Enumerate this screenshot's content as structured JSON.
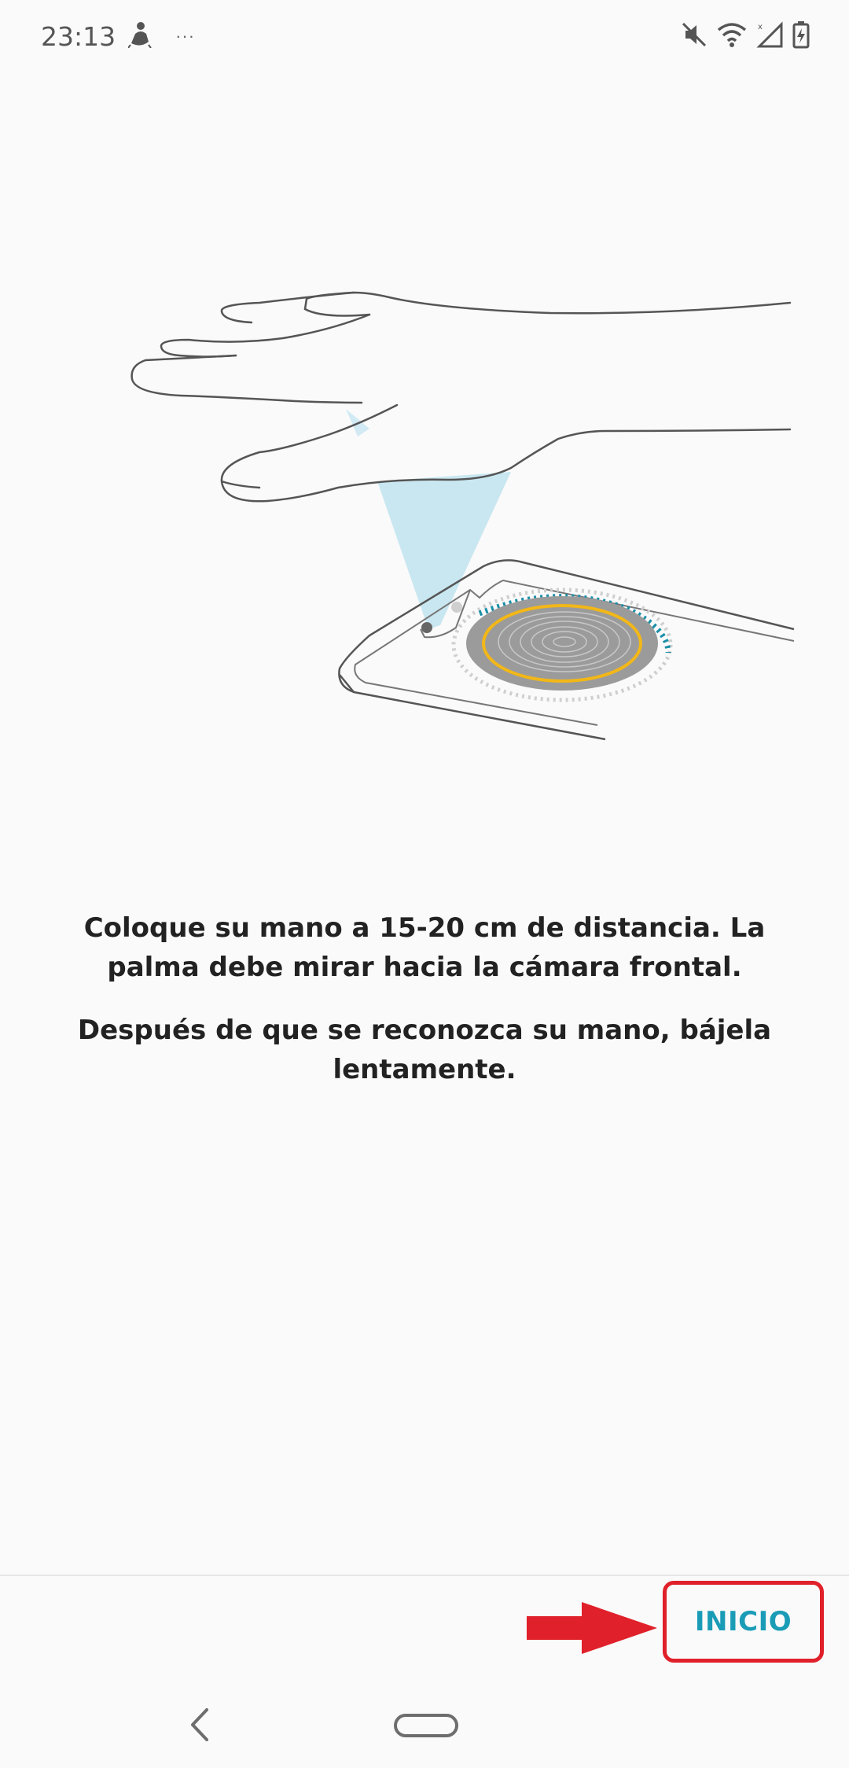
{
  "status_bar": {
    "time": "23:13",
    "notification_icons": [
      "person-walking-icon"
    ],
    "overflow": "···",
    "system_icons": [
      "mute-icon",
      "wifi-icon",
      "signal-icon",
      "battery-charging-icon"
    ]
  },
  "illustration": {
    "subject": "hand-over-phone-illustration",
    "accent_colors": {
      "beam": "#bfe3ef",
      "ring_dashes": "#1a8fa8",
      "gold_ring": "#f2b718",
      "disc": "#9b9b9b"
    }
  },
  "instructions": {
    "paragraph_1": "Coloque su mano a 15-20 cm de distancia. La palma debe mirar hacia la cámara frontal.",
    "paragraph_2": "Después de que se reconozca su mano, bájela lentamente."
  },
  "footer": {
    "start_label": "INICIO",
    "start_color": "#1a9cb7",
    "highlight_color": "#e0202a"
  },
  "nav": {
    "back_icon": "back-icon",
    "home_icon": "home-pill-icon"
  }
}
